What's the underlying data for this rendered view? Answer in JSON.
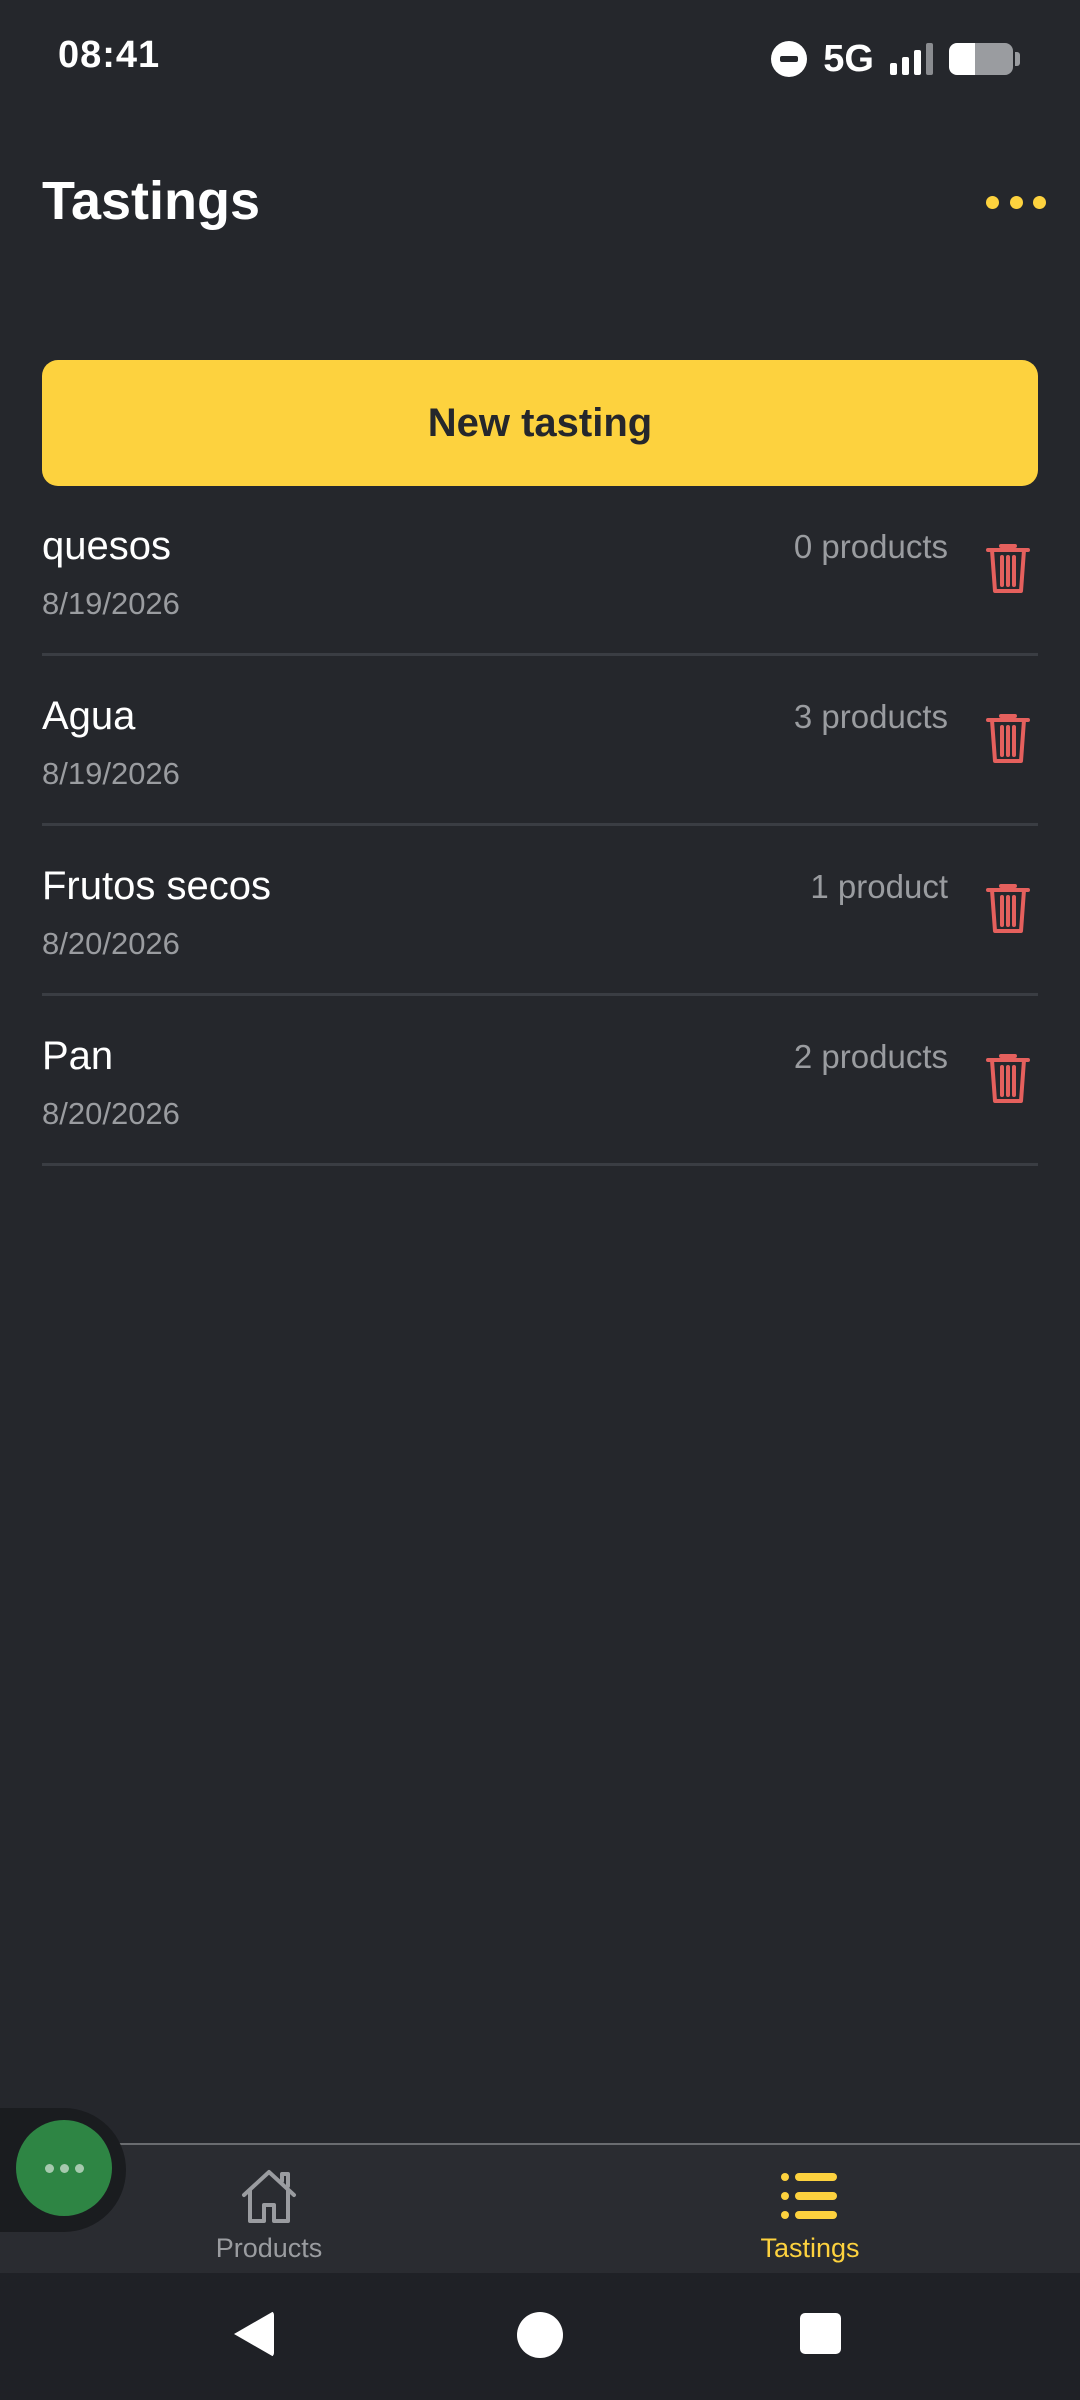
{
  "status_bar": {
    "time": "08:41",
    "network": "5G",
    "battery_level": 0.4
  },
  "header": {
    "title": "Tastings",
    "more_icon": "more-horizontal-icon"
  },
  "new_tasting_label": "New tasting",
  "tastings": [
    {
      "name": "quesos",
      "date": "8/19/2026",
      "count": "0 products"
    },
    {
      "name": "Agua",
      "date": "8/19/2026",
      "count": "3 products"
    },
    {
      "name": "Frutos secos",
      "date": "8/20/2026",
      "count": "1 product"
    },
    {
      "name": "Pan",
      "date": "8/20/2026",
      "count": "2 products"
    }
  ],
  "tabs": [
    {
      "label": "Products",
      "icon": "home-icon",
      "active": false
    },
    {
      "label": "Tastings",
      "icon": "list-icon",
      "active": true
    }
  ],
  "colors": {
    "background": "#25272c",
    "accent": "#fdd23e",
    "delete": "#e5605d",
    "muted_text": "#9a9ca0",
    "assist": "#2e8544"
  }
}
